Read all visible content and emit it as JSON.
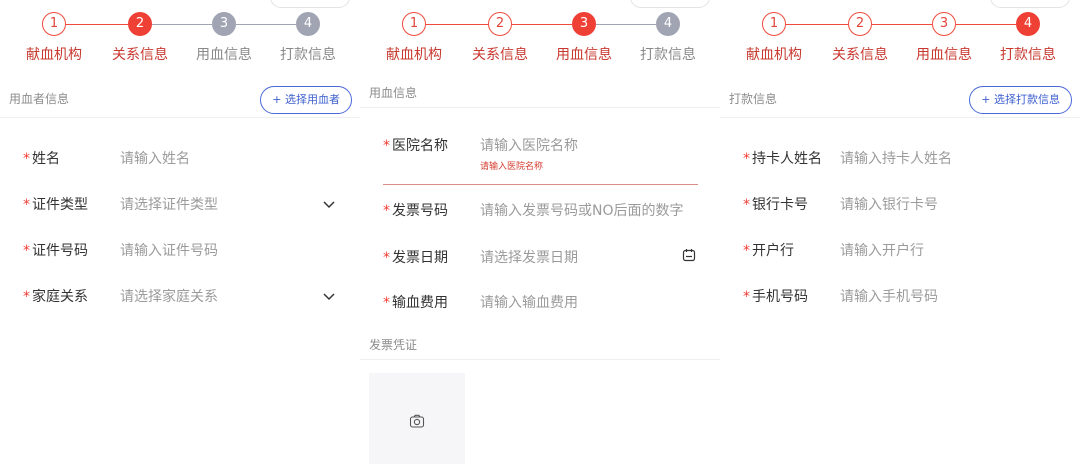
{
  "step_labels": [
    "献血机构",
    "关系信息",
    "用血信息",
    "打款信息"
  ],
  "step_numbers": [
    "1",
    "2",
    "3",
    "4"
  ],
  "colors": {
    "accent": "#ef4036",
    "step_todo": "#a1a4b3",
    "link_blue": "#3d5fcf",
    "error": "#d43c2f"
  },
  "panel1": {
    "section_title": "用血者信息",
    "select_button": "+ 选择用血者",
    "fields": [
      {
        "label": "姓名",
        "placeholder": "请输入姓名"
      },
      {
        "label": "证件类型",
        "placeholder": "请选择证件类型"
      },
      {
        "label": "证件号码",
        "placeholder": "请输入证件号码"
      },
      {
        "label": "家庭关系",
        "placeholder": "请选择家庭关系"
      }
    ]
  },
  "panel2": {
    "section_title": "用血信息",
    "fields": [
      {
        "label": "医院名称",
        "placeholder": "请输入医院名称",
        "error": "请输入医院名称"
      },
      {
        "label": "发票号码",
        "placeholder": "请输入发票号码或NO后面的数字"
      },
      {
        "label": "发票日期",
        "placeholder": "请选择发票日期"
      },
      {
        "label": "输血费用",
        "placeholder": "请输入输血费用"
      }
    ],
    "voucher_title": "发票凭证"
  },
  "panel3": {
    "section_title": "打款信息",
    "select_button": "+ 选择打款信息",
    "fields": [
      {
        "label": "持卡人姓名",
        "placeholder": "请输入持卡人姓名"
      },
      {
        "label": "银行卡号",
        "placeholder": "请输入银行卡号"
      },
      {
        "label": "开户行",
        "placeholder": "请输入开户行"
      },
      {
        "label": "手机号码",
        "placeholder": "请输入手机号码"
      }
    ]
  }
}
